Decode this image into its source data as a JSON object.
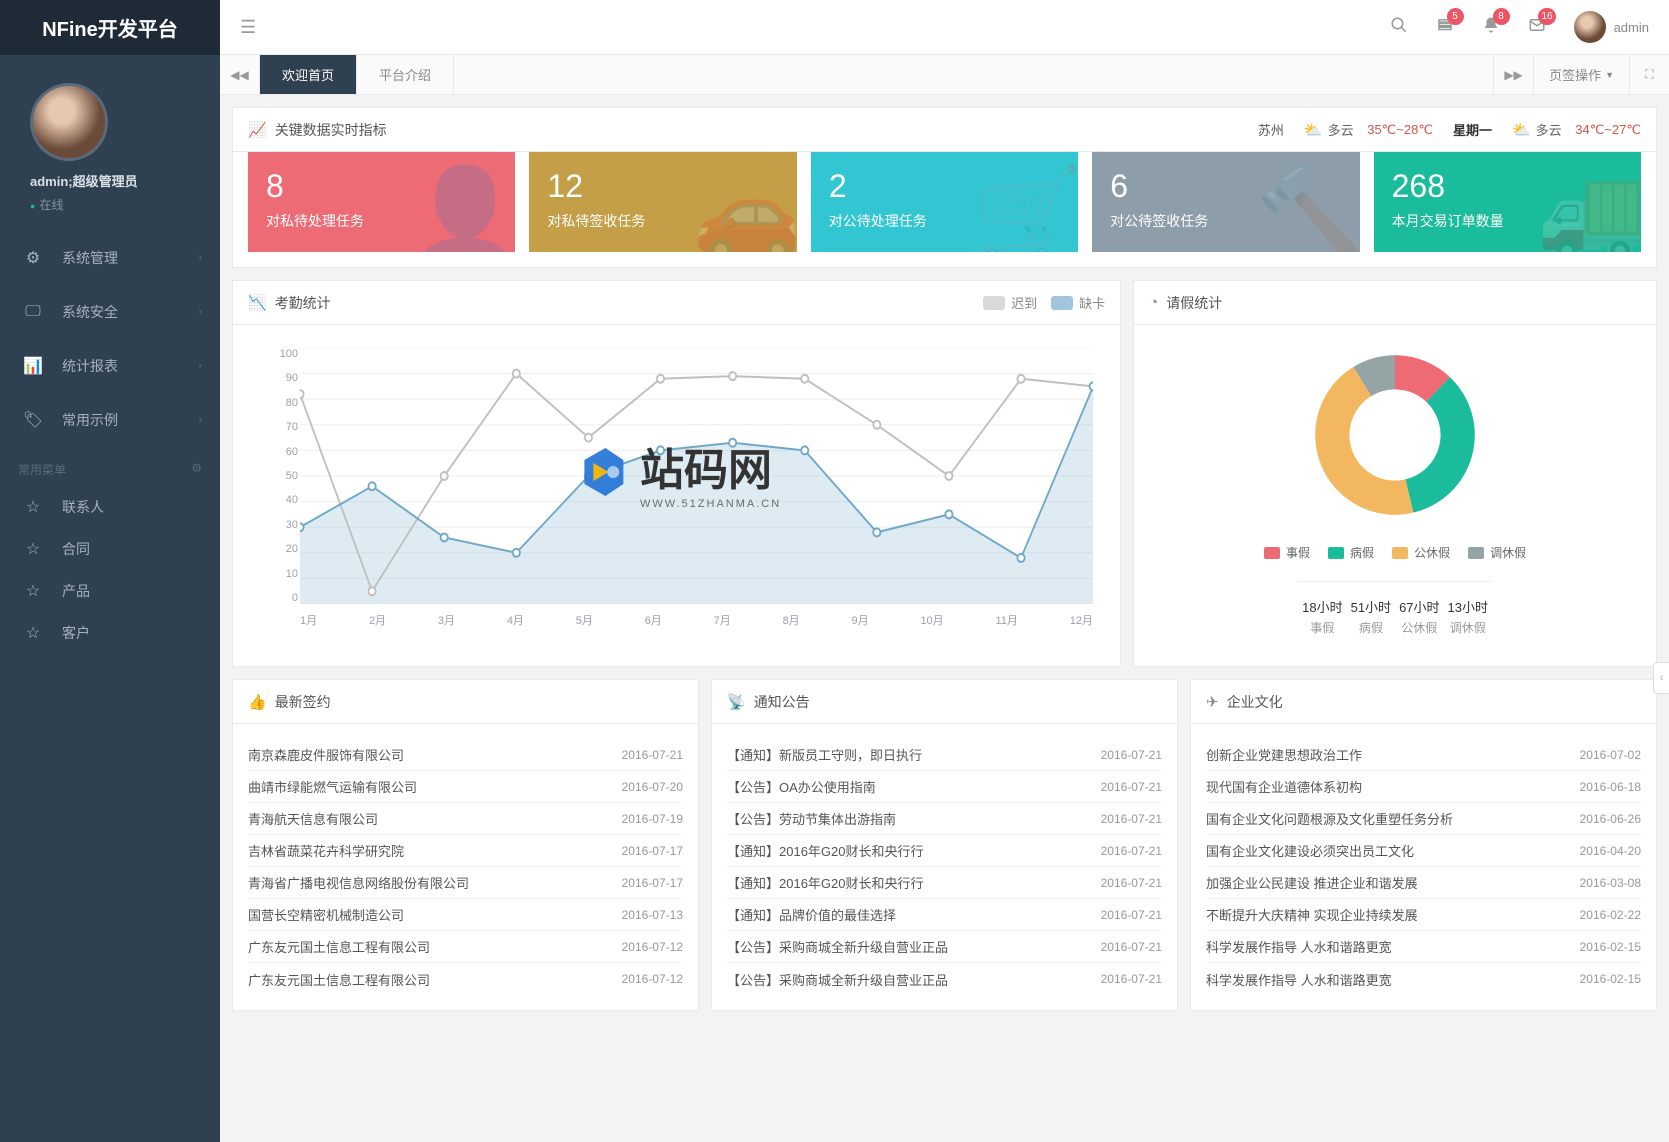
{
  "logo": "NFine开发平台",
  "user": {
    "name": "admin;超级管理员",
    "status": "在线",
    "top_name": "admin"
  },
  "sidebar": {
    "items": [
      {
        "icon": "⚙",
        "label": "系统管理"
      },
      {
        "icon": "🖵",
        "label": "系统安全"
      },
      {
        "icon": "📊",
        "label": "统计报表"
      },
      {
        "icon": "🏷",
        "label": "常用示例"
      }
    ],
    "menu_title": "常用菜单",
    "sub_items": [
      {
        "label": "联系人"
      },
      {
        "label": "合同"
      },
      {
        "label": "产品"
      },
      {
        "label": "客户"
      }
    ]
  },
  "topbar": {
    "badges": {
      "flag": "5",
      "bell": "8",
      "mail": "16"
    }
  },
  "tabbar": {
    "tabs": [
      "欢迎首页",
      "平台介绍"
    ],
    "ops": "页签操作"
  },
  "kpi_title": "关键数据实时指标",
  "weather": {
    "city": "苏州",
    "desc1": "多云",
    "temp1": "35℃~28℃",
    "day": "星期一",
    "desc2": "多云",
    "temp2": "34℃~27℃"
  },
  "cards": [
    {
      "num": "8",
      "label": "对私待处理任务",
      "icon": "👤"
    },
    {
      "num": "12",
      "label": "对私待签收任务",
      "icon": "🚗"
    },
    {
      "num": "2",
      "label": "对公待处理任务",
      "icon": "🛒"
    },
    {
      "num": "6",
      "label": "对公待签收任务",
      "icon": "🔨"
    },
    {
      "num": "268",
      "label": "本月交易订单数量",
      "icon": "🚚"
    }
  ],
  "attendance": {
    "title": "考勤统计",
    "legend": {
      "late": "迟到",
      "miss": "缺卡"
    },
    "colors": {
      "late": "#d9d9d9",
      "miss": "#a0c5dd"
    }
  },
  "leave": {
    "title": "请假统计",
    "legend": [
      "事假",
      "病假",
      "公休假",
      "调休假"
    ],
    "colors": [
      "#ed6b75",
      "#1bbc9b",
      "#f3b760",
      "#95a5a6"
    ],
    "stats": [
      {
        "val": "18小时",
        "lab": "事假"
      },
      {
        "val": "51小时",
        "lab": "病假"
      },
      {
        "val": "67小时",
        "lab": "公休假"
      },
      {
        "val": "13小时",
        "lab": "调休假"
      }
    ]
  },
  "panels": {
    "signings": {
      "title": "最新签约",
      "items": [
        {
          "name": "南京森鹿皮件服饰有限公司",
          "date": "2016-07-21"
        },
        {
          "name": "曲靖市绿能燃气运输有限公司",
          "date": "2016-07-20"
        },
        {
          "name": "青海航天信息有限公司",
          "date": "2016-07-19"
        },
        {
          "name": "吉林省蔬菜花卉科学研究院",
          "date": "2016-07-17"
        },
        {
          "name": "青海省广播电视信息网络股份有限公司",
          "date": "2016-07-17"
        },
        {
          "name": "国营长空精密机械制造公司",
          "date": "2016-07-13"
        },
        {
          "name": "广东友元国土信息工程有限公司",
          "date": "2016-07-12"
        },
        {
          "name": "广东友元国土信息工程有限公司",
          "date": "2016-07-12"
        }
      ]
    },
    "notices": {
      "title": "通知公告",
      "items": [
        {
          "name": "【通知】新版员工守则，即日执行",
          "date": "2016-07-21"
        },
        {
          "name": "【公告】OA办公使用指南",
          "date": "2016-07-21"
        },
        {
          "name": "【公告】劳动节集体出游指南",
          "date": "2016-07-21"
        },
        {
          "name": "【通知】2016年G20财长和央行行",
          "date": "2016-07-21"
        },
        {
          "name": "【通知】2016年G20财长和央行行",
          "date": "2016-07-21"
        },
        {
          "name": "【通知】品牌价值的最佳选择",
          "date": "2016-07-21"
        },
        {
          "name": "【公告】采购商城全新升级自营业正品",
          "date": "2016-07-21"
        },
        {
          "name": "【公告】采购商城全新升级自营业正品",
          "date": "2016-07-21"
        }
      ]
    },
    "culture": {
      "title": "企业文化",
      "items": [
        {
          "name": "创新企业党建思想政治工作",
          "date": "2016-07-02"
        },
        {
          "name": "现代国有企业道德体系初构",
          "date": "2016-06-18"
        },
        {
          "name": "国有企业文化问题根源及文化重塑任务分析",
          "date": "2016-06-26"
        },
        {
          "name": "国有企业文化建设必须突出员工文化",
          "date": "2016-04-20"
        },
        {
          "name": "加强企业公民建设 推进企业和谐发展",
          "date": "2016-03-08"
        },
        {
          "name": "不断提升大庆精神 实现企业持续发展",
          "date": "2016-02-22"
        },
        {
          "name": "科学发展作指导 人水和谐路更宽",
          "date": "2016-02-15"
        },
        {
          "name": "科学发展作指导 人水和谐路更宽",
          "date": "2016-02-15"
        }
      ]
    }
  },
  "watermark": {
    "text": "站码网",
    "sub": "WWW.51ZHANMA.CN"
  },
  "chart_data": [
    {
      "type": "line",
      "title": "考勤统计",
      "xlabel": "",
      "ylabel": "",
      "ylim": [
        0,
        100
      ],
      "categories": [
        "1月",
        "2月",
        "3月",
        "4月",
        "5月",
        "6月",
        "7月",
        "8月",
        "9月",
        "10月",
        "11月",
        "12月"
      ],
      "series": [
        {
          "name": "迟到",
          "values": [
            82,
            5,
            50,
            90,
            65,
            88,
            89,
            88,
            70,
            50,
            88,
            85
          ]
        },
        {
          "name": "缺卡",
          "values": [
            30,
            46,
            26,
            20,
            50,
            60,
            63,
            60,
            28,
            35,
            18,
            85
          ]
        }
      ]
    },
    {
      "type": "pie",
      "title": "请假统计",
      "series": [
        {
          "name": "事假",
          "value": 18
        },
        {
          "name": "病假",
          "value": 51
        },
        {
          "name": "公休假",
          "value": 67
        },
        {
          "name": "调休假",
          "value": 13
        }
      ]
    }
  ]
}
